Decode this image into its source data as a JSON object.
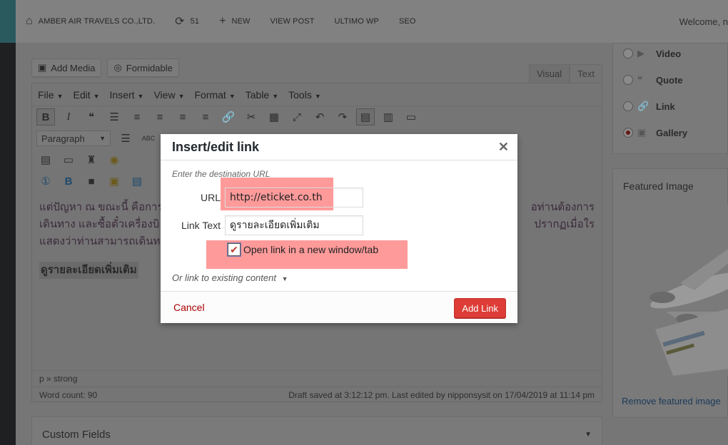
{
  "adminbar": {
    "site_name": "AMBER AIR TRAVELS CO.,LTD.",
    "updates_count": "51",
    "new_label": "NEW",
    "view_post": "VIEW POST",
    "ultimo": "ULTIMO WP",
    "seo": "SEO",
    "welcome": "Welcome, n"
  },
  "editor": {
    "add_media": "Add Media",
    "formidable": "Formidable",
    "tab_visual": "Visual",
    "tab_text": "Text",
    "menus": [
      "File",
      "Edit",
      "Insert",
      "View",
      "Format",
      "Table",
      "Tools"
    ],
    "format_select": "Paragraph",
    "content_lines": [
      "แต่ปัญหา ณ ขณะนี้ คือการ",
      "เดินทาง และซื้อตั๋วเครื่องบิ",
      "แสดงว่าท่านสามารถเดินท"
    ],
    "content_right": [
      "อท่านต้องการ",
      "ปรากฏเมื่อใร"
    ],
    "bold_line": "ดูรายละเอียดเพิ่มเติม",
    "path": "p » strong",
    "word_count": "Word count: 90",
    "draft_status": "Draft saved at 3:12:12 pm. Last edited by nipponsysit on 17/04/2019 at 11:14 pm"
  },
  "custom_fields": {
    "title": "Custom Fields"
  },
  "format_box": {
    "options": [
      {
        "label": "Video",
        "checked": false
      },
      {
        "label": "Quote",
        "checked": false
      },
      {
        "label": "Link",
        "checked": false
      },
      {
        "label": "Gallery",
        "checked": true
      }
    ]
  },
  "featured": {
    "title": "Featured Image",
    "remove": "Remove featured image"
  },
  "modal": {
    "title": "Insert/edit link",
    "hint": "Enter the destination URL",
    "url_label": "URL",
    "url_value": "http://eticket.co.th",
    "text_label": "Link Text",
    "text_value": "ดูรายละเอียดเพิ่มเติม",
    "new_window_label": "Open link in a new window/tab",
    "new_window_checked": true,
    "existing": "Or link to existing content",
    "cancel": "Cancel",
    "add_link": "Add Link",
    "highlight_color": "#ff6464"
  }
}
